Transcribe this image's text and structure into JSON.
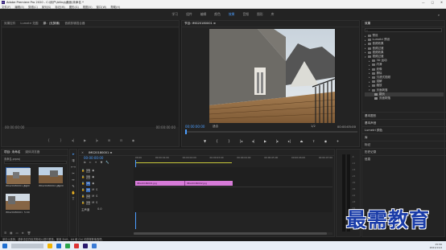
{
  "window": {
    "app_icon": "Pr",
    "title": "Adobe Premiere Pro 2020 - C:\\用户\\Ailing\\桌面\\未命名 *"
  },
  "menubar": {
    "items": [
      "文件(F)",
      "编辑(E)",
      "剪辑(C)",
      "序列(S)",
      "标记(M)",
      "图形(G)",
      "视图(V)",
      "窗口(W)",
      "帮助(H)"
    ]
  },
  "workspaces": {
    "items": [
      "学习",
      "组件",
      "编辑",
      "颜色",
      "效果",
      "音频",
      "图形",
      "库"
    ],
    "active_index": 4
  },
  "source_panel": {
    "tabs": [
      "效果控件",
      "Lumetri 范围",
      "源：(无剪辑)",
      "音频剪辑混合器"
    ],
    "active_tab": 2,
    "timecode_left": "00:00:00:00",
    "timecode_right": "00:00:00:00"
  },
  "program_panel": {
    "tab": "节目: IMG20180001 ≡",
    "timecode_left": "00:00:00:00",
    "fit": "适合",
    "ratio": "1/2",
    "timecode_right": "00:00:05:00"
  },
  "effects_panel": {
    "title": "效果",
    "search_placeholder": "",
    "tree": [
      {
        "label": "预设",
        "depth": 0
      },
      {
        "label": "Lumetri 预设",
        "depth": 0
      },
      {
        "label": "音频效果",
        "depth": 0
      },
      {
        "label": "音频过渡",
        "depth": 0
      },
      {
        "label": "视频效果",
        "depth": 0
      },
      {
        "label": "视频过渡",
        "depth": 0
      },
      {
        "label": "3D 运动",
        "depth": 1
      },
      {
        "label": "内滑",
        "depth": 1
      },
      {
        "label": "划像",
        "depth": 1
      },
      {
        "label": "擦除",
        "depth": 1
      },
      {
        "label": "沉浸式视频",
        "depth": 1
      },
      {
        "label": "溶解",
        "depth": 1
      },
      {
        "label": "缩放",
        "depth": 1
      },
      {
        "label": "页面剥落",
        "depth": 1
      },
      {
        "label": "翻页",
        "depth": 2
      },
      {
        "label": "页面剥落",
        "depth": 2
      }
    ],
    "selected_index": 14,
    "sections": [
      "基本图形",
      "基本声音",
      "Lumetri 颜色",
      "库",
      "标记",
      "历史记录",
      "信息"
    ]
  },
  "project_panel": {
    "tabs": [
      "项目: 未命名",
      "媒体浏览器"
    ],
    "path": "未命名.prproj",
    "items": [
      {
        "name": "IMG20180001.jpg",
        "duration": "5:00"
      },
      {
        "name": "IMG20180002.jpg",
        "duration": "5:00"
      },
      {
        "name": "IMG20180001",
        "duration": "5:00"
      }
    ]
  },
  "timeline": {
    "tab": "IMG20180001 ≡",
    "timecode": "00:00:00:00",
    "ruler": [
      "00:00",
      "00:00:01:00",
      "00:00:02:00",
      "00:00:03:00",
      "00:00:04:00",
      "00:00:05:00",
      "00:00:06:00",
      "00:00:07:00",
      "00:00:08:00"
    ],
    "tracks": [
      {
        "name": "V3",
        "kind": "video"
      },
      {
        "name": "V2",
        "kind": "video"
      },
      {
        "name": "V1",
        "kind": "video"
      },
      {
        "name": "A1",
        "kind": "audio"
      },
      {
        "name": "A2",
        "kind": "audio"
      },
      {
        "name": "A3",
        "kind": "audio"
      },
      {
        "name": "主声道",
        "kind": "master",
        "value": "0.0"
      }
    ],
    "clips": [
      {
        "label": "IMG20180001.jpg",
        "track": "V1"
      },
      {
        "label": "IMG20180002.jpg",
        "track": "V1"
      }
    ]
  },
  "statusbar": {
    "text": "单击以选择，或单击空白处并拖动以进行框选。使用 Shift、Alt 和 Ctrl 可获得其他选项。"
  },
  "taskbar": {
    "time": "15:56",
    "date": "2021/11/4"
  },
  "watermark": {
    "text": "最需教育"
  },
  "colors": {
    "accent": "#4c9eff",
    "clip": "#d67bd8",
    "bg": "#1d1d1d"
  }
}
